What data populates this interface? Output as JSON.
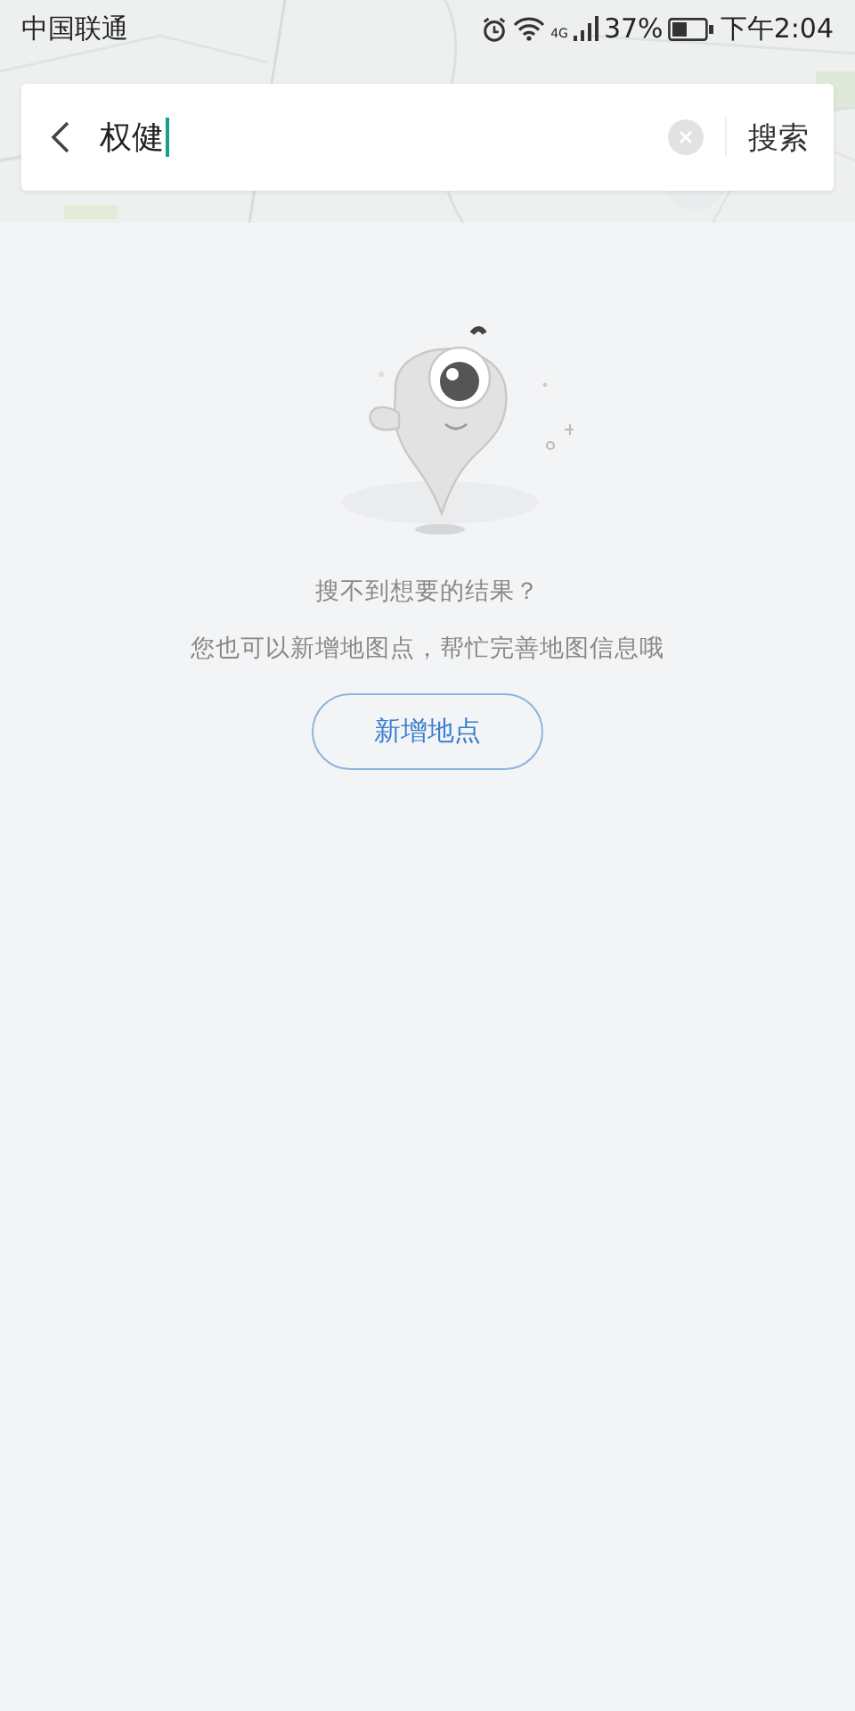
{
  "status_bar": {
    "carrier": "中国联通",
    "network": "4G",
    "battery": "37%",
    "time": "下午2:04"
  },
  "search": {
    "value": "权健",
    "button": "搜索"
  },
  "empty_state": {
    "title": "搜不到想要的结果？",
    "message": "您也可以新增地图点，帮忙完善地图信息哦",
    "action": "新增地点"
  }
}
